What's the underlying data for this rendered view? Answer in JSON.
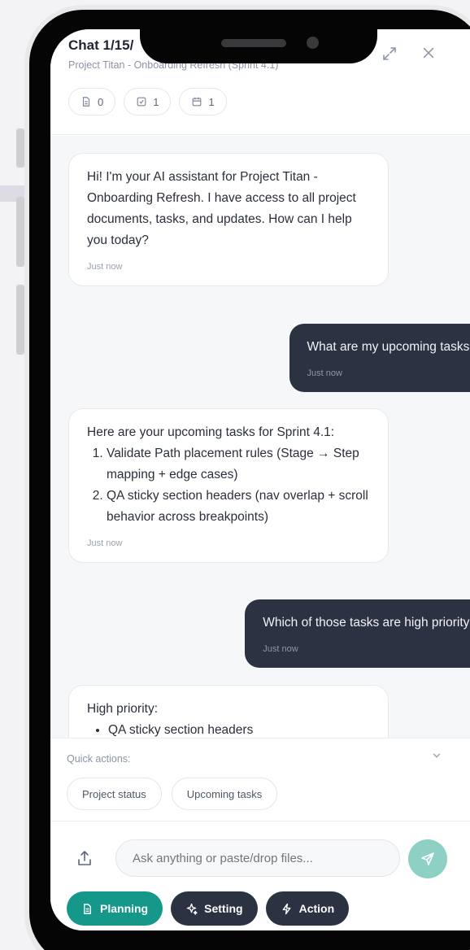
{
  "header": {
    "title": "Chat 1/15/",
    "subtitle": "Project Titan - Onboarding Refresh (Sprint 4.1)",
    "chips": [
      {
        "icon": "document-icon",
        "count": "0"
      },
      {
        "icon": "checkbox-icon",
        "count": "1"
      },
      {
        "icon": "calendar-icon",
        "count": "1"
      }
    ],
    "expand_icon": "expand-icon",
    "close_icon": "close-icon"
  },
  "messages": [
    {
      "role": "ai",
      "text": "Hi! I'm your AI assistant for Project Titan - Onboarding Refresh. I have access to all project documents, tasks, and updates. How can I help you today?",
      "time": "Just now"
    },
    {
      "role": "user",
      "text": "What are my upcoming tasks?",
      "time": "Just now"
    },
    {
      "role": "ai",
      "intro": "Here are your upcoming tasks for Sprint 4.1:",
      "items": [
        "Validate Path placement rules (Stage → Step mapping + edge cases)",
        "QA sticky section headers (nav overlap + scroll behavior across breakpoints)"
      ],
      "time": "Just now"
    },
    {
      "role": "user",
      "text": "Which of those tasks are high priority?",
      "time": "Just now"
    },
    {
      "role": "ai",
      "intro": "High priority:",
      "items": [
        "QA sticky section headers"
      ]
    }
  ],
  "quick_actions": {
    "label": "Quick actions:",
    "items": [
      "Project status",
      "Upcoming tasks"
    ]
  },
  "composer": {
    "placeholder": "Ask anything or paste/drop files...",
    "modes": [
      {
        "label": "Planning",
        "icon": "document-icon",
        "active": true
      },
      {
        "label": "Setting",
        "icon": "sparkle-icon",
        "active": false
      },
      {
        "label": "Action",
        "icon": "bolt-icon",
        "active": false
      }
    ]
  },
  "colors": {
    "accent": "#15988a",
    "user_bubble": "#2b3241",
    "send_button": "#8fd0c4"
  }
}
